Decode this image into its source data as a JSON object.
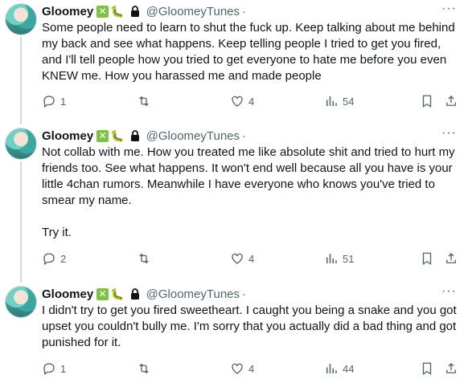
{
  "tweets": [
    {
      "author": "Gloomey",
      "verified_badge": "✕",
      "emoji": "🐛",
      "handle": "@GloomeyTunes",
      "separator": "·",
      "more": "···",
      "text": "Some people need to learn to shut the fuck up. Keep talking about me behind my back and see what happens. Keep telling people I tried to get you fired, and I'll tell people how you tried to get everyone to hate me before you even KNEW me. How you harassed me and made people",
      "replies": "1",
      "likes": "4",
      "views": "54"
    },
    {
      "author": "Gloomey",
      "verified_badge": "✕",
      "emoji": "🐛",
      "handle": "@GloomeyTunes",
      "separator": "·",
      "more": "···",
      "text": "Not collab with me. How you treated me like absolute shit and tried to hurt my friends too. See what happens. It won't end well because all you have is your little 4chan rumors. Meanwhile I have everyone who knows you've tried to smear my name.\n\nTry it.",
      "replies": "2",
      "likes": "4",
      "views": "51"
    },
    {
      "author": "Gloomey",
      "verified_badge": "✕",
      "emoji": "🐛",
      "handle": "@GloomeyTunes",
      "separator": "·",
      "more": "···",
      "text": "I didn't try to get you fired sweetheart. I caught you being a snake and you got upset you couldn't bully me. I'm sorry that you actually did a bad thing and got punished for it.",
      "replies": "1",
      "likes": "4",
      "views": "44"
    }
  ],
  "icons": [
    "reply-icon",
    "retweet-icon",
    "like-icon",
    "views-icon",
    "bookmark-icon",
    "share-icon"
  ]
}
